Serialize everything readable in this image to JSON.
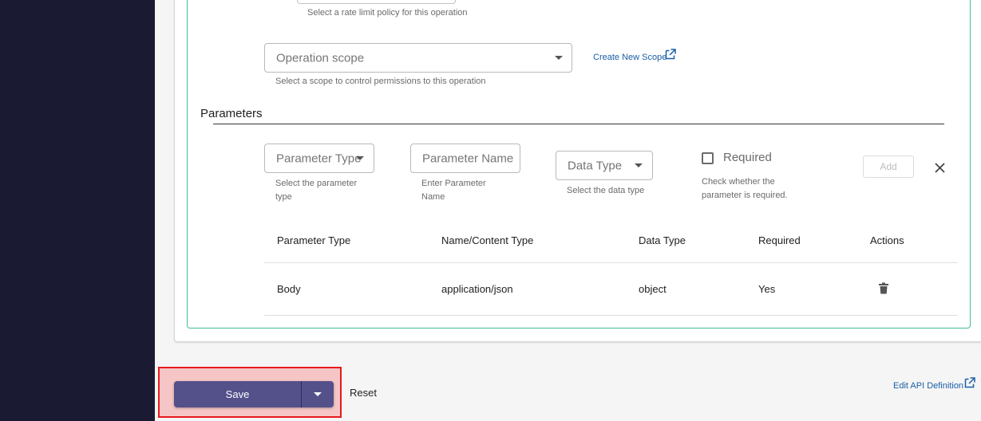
{
  "rate_limit": {
    "helper": "Select a rate limit policy for this operation"
  },
  "operation_scope": {
    "placeholder": "Operation scope",
    "helper": "Select a scope to control permissions to this operation",
    "create_link": "Create New Scope"
  },
  "parameters": {
    "title": "Parameters",
    "form": {
      "param_type_placeholder": "Parameter Type",
      "param_type_helper_1": "Select the parameter",
      "param_type_helper_2": "type",
      "param_name_placeholder": "Parameter Name",
      "param_name_helper_1": "Enter Parameter",
      "param_name_helper_2": "Name",
      "data_type_placeholder": "Data Type",
      "data_type_helper": "Select the data type",
      "required_label": "Required",
      "required_helper_1": "Check whether the",
      "required_helper_2": "parameter is required.",
      "required_checked": false,
      "add_label": "Add"
    },
    "table": {
      "headers": [
        "Parameter Type",
        "Name/Content Type",
        "Data Type",
        "Required",
        "Actions"
      ],
      "rows": [
        [
          "Body",
          "application/json",
          "object",
          "Yes"
        ]
      ]
    }
  },
  "footer": {
    "save_label": "Save",
    "reset_label": "Reset",
    "edit_definition_label": "Edit API Definition"
  },
  "colors": {
    "sidebar": "#1b1a33",
    "accent_green": "#3fc08f",
    "primary_button": "#54508a",
    "link": "#1a5fa6",
    "highlight_border": "#e8191b"
  }
}
